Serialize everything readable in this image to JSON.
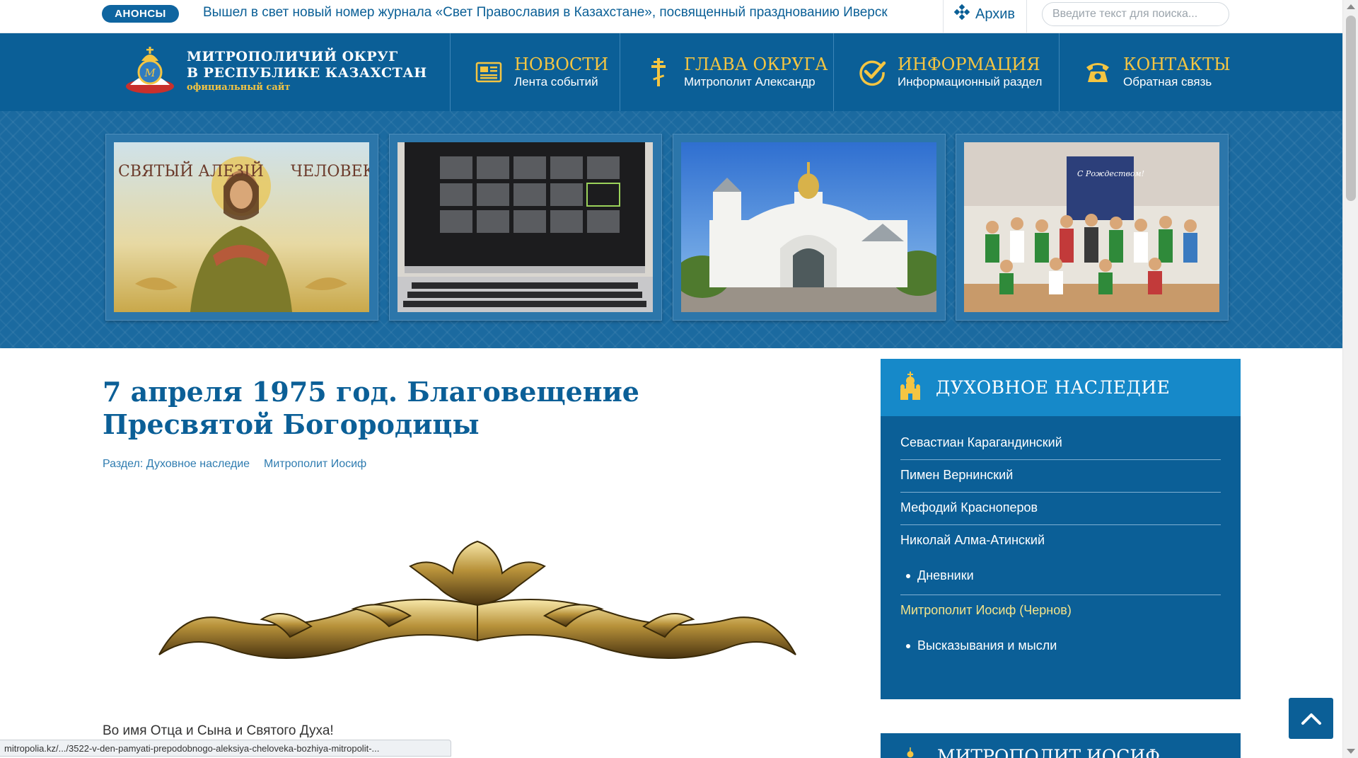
{
  "announcement": {
    "badge": "АНОНСЫ",
    "text": "Вышел в свет новый номер журнала «Свет Православия в Казахстане», посвященный празднованию Иверск",
    "archive_label": "Архив"
  },
  "search": {
    "placeholder": "Введите текст для поиска..."
  },
  "logo": {
    "line1": "МИТРОПОЛИЧИЙ ОКРУГ",
    "line2": "В РЕСПУБЛИКЕ КАЗАХСТАН",
    "sub": "официальный сайт"
  },
  "nav": [
    {
      "title": "НОВОСТИ",
      "subtitle": "Лента событий",
      "icon": "newspaper-icon"
    },
    {
      "title": "ГЛАВА ОКРУГА",
      "subtitle": "Митрополит Александр",
      "icon": "cross-icon"
    },
    {
      "title": "ИНФОРМАЦИЯ",
      "subtitle": "Информационный раздел",
      "icon": "check-circle-icon"
    },
    {
      "title": "КОНТАКТЫ",
      "subtitle": "Обратная связь",
      "icon": "phone-icon"
    }
  ],
  "banner": {
    "thumbs": [
      {
        "name": "icon-saint-alexius",
        "caption_left": "СВЯТЫЙ АЛЕЗІЙ",
        "caption_right": "ЧЕЛОВЕКЪ БЖІЙ"
      },
      {
        "name": "laptop-video-conference"
      },
      {
        "name": "white-church"
      },
      {
        "name": "christmas-children-group",
        "caption": "С Рождеством!"
      }
    ]
  },
  "article": {
    "title": "7 апреля 1975 год. Благовещение Пресвятой Богородицы",
    "section_label": "Раздел: Духовное наследие",
    "author": "Митрополит Иосиф",
    "body_first_line": "Во имя Отца и Сына и Святого Духа!"
  },
  "sidebar": {
    "title": "ДУХОВНОЕ НАСЛЕДИЕ",
    "items": [
      {
        "label": "Севастиан Карагандинский"
      },
      {
        "label": "Пимен Вернинский"
      },
      {
        "label": "Мефодий Красноперов"
      },
      {
        "label": "Николай Алма-Атинский"
      }
    ],
    "sub_after_nikolai": "Дневники",
    "active_item": "Митрополит Иосиф (Чернов)",
    "sub_after_active": "Высказывания и мысли"
  },
  "sidebar2": {
    "title": "МИТРОПОЛИТ ИОСИФ"
  },
  "status_bar": {
    "url": "mitropolia.kz/.../3522-v-den-pamyati-prepodobnogo-aleksiya-cheloveka-bozhiya-mitropolit-..."
  },
  "colors": {
    "primary": "#0b5f97",
    "sidebar_head": "#1689c9",
    "gold": "#f4c542",
    "active_link": "#f4e48a"
  }
}
